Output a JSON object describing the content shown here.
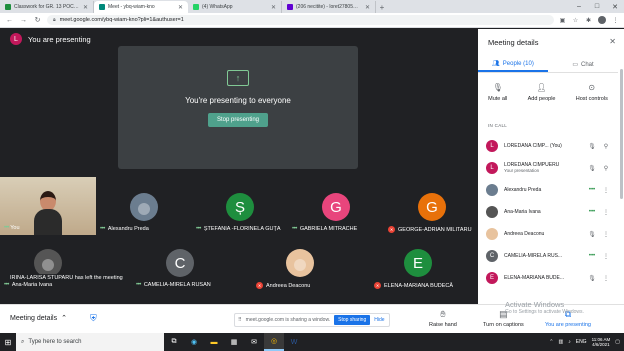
{
  "browser": {
    "tabs": [
      {
        "title": "Classwork for GR. 13 POCU/375/",
        "favicon_color": "#1e8e3e",
        "active": false
      },
      {
        "title": "Meet - ybq-wiam-kno",
        "favicon_color": "#00897b",
        "active": true
      },
      {
        "title": "(4) WhatsApp",
        "favicon_color": "#25d366",
        "active": false
      },
      {
        "title": "(206 necitite) - loret27805@yah",
        "favicon_color": "#6001d2",
        "active": false
      }
    ],
    "url": "meet.google.com/ybq-wiam-kno?pli=1&authuser=1"
  },
  "meet": {
    "presenting_label": "You are presenting",
    "self_initial": "L",
    "present_message": "You're presenting to everyone",
    "stop_presenting": "Stop presenting",
    "self_tile_label": "You",
    "tiles": [
      {
        "name": "Alexandru Preda",
        "initial": "",
        "color": "#6b7d8f",
        "mic": "on"
      },
      {
        "name": "ȘTEFANIA -FLORINELA GUȚĂ",
        "initial": "Ș",
        "color": "#1e8e3e",
        "mic": "on"
      },
      {
        "name": "GABRIELA MITRACHE",
        "initial": "G",
        "color": "#e8457c",
        "mic": "on"
      },
      {
        "name": "GEORGE-ADRIAN MILITARU",
        "initial": "G",
        "color": "#e8710a",
        "mic": "muted"
      },
      {
        "name": "Ana-Maria Ivana",
        "initial": "",
        "color": "#555555",
        "mic": "on"
      },
      {
        "name": "CAMELIA-MIRELA RUSAN",
        "initial": "C",
        "color": "#5f6368",
        "mic": "on"
      },
      {
        "name": "Andreea Deaconu",
        "initial": "",
        "color": "#e8c39e",
        "mic": "muted"
      },
      {
        "name": "ELENA-MARIANA BUDECĂ",
        "initial": "E",
        "color": "#1e8e3e",
        "mic": "muted"
      }
    ],
    "toast": "IRINA-LARISA STUPARU has left the meeting"
  },
  "bottom": {
    "meeting_details": "Meeting details",
    "share_text": "meet.google.com is sharing a window.",
    "stop_sharing": "Stop sharing",
    "hide": "Hide",
    "raise_hand": "Raise hand",
    "captions": "Turn on captions",
    "presenting": "You are presenting",
    "watermark_title": "Activate Windows",
    "watermark_sub": "Go to Settings to activate Windows."
  },
  "panel": {
    "title": "Meeting details",
    "tab_people": "People (10)",
    "tab_chat": "Chat",
    "action_mute": "Mute all",
    "action_add": "Add people",
    "action_host": "Host controls",
    "in_call": "IN CALL",
    "people": [
      {
        "name": "LOREDANA CIMP... (You)",
        "sub": "",
        "initial": "L",
        "color": "#c2185b",
        "mic": "off",
        "end": "pin"
      },
      {
        "name": "LOREDANA CIMPUERU",
        "sub": "Your presentation",
        "initial": "L",
        "color": "#c2185b",
        "mic": "off",
        "end": "pin"
      },
      {
        "name": "Alexandru Preda",
        "sub": "",
        "initial": "",
        "color": "#6b7d8f",
        "mic": "on",
        "end": "more"
      },
      {
        "name": "Ana-Maria Ivana",
        "sub": "",
        "initial": "",
        "color": "#555555",
        "mic": "on",
        "end": "more"
      },
      {
        "name": "Andreea Deaconu",
        "sub": "",
        "initial": "",
        "color": "#e8c39e",
        "mic": "off",
        "end": "more"
      },
      {
        "name": "CAMELIA-MIRELA RUS...",
        "sub": "",
        "initial": "C",
        "color": "#5f6368",
        "mic": "on",
        "end": "more"
      },
      {
        "name": "ELENA-MARIANA BUDE...",
        "sub": "",
        "initial": "E",
        "color": "#c2185b",
        "mic": "off",
        "end": "more"
      }
    ]
  },
  "taskbar": {
    "search_placeholder": "Type here to search",
    "language": "ENG",
    "time": "11:06 AM",
    "date": "4/6/2021"
  }
}
